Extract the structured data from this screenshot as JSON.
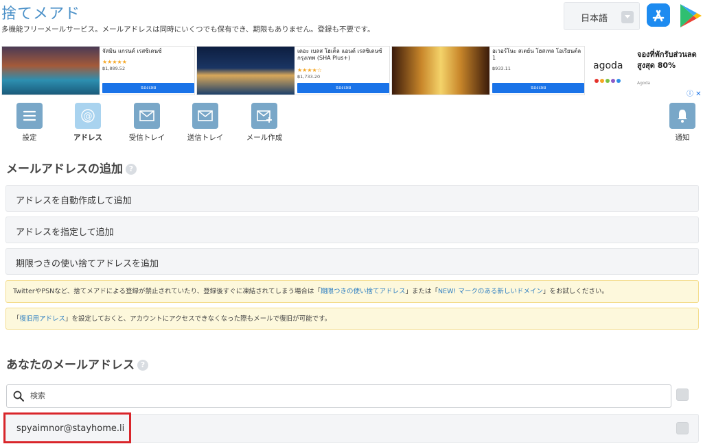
{
  "header": {
    "logo": "捨てメアド",
    "tagline": "多機能フリーメールサービス。メールアドレスは同時にいくつでも保有でき、期限もありません。登録も不要です。",
    "language": "日本語"
  },
  "ad": {
    "cards": [
      {
        "title": "จัสมิน แกรนด์ เรสซิเดนซ์",
        "stars": "★★★★★",
        "price": "฿1,889.52",
        "button": "จองเลย"
      },
      {
        "title": "เดอะ เบลส โฮเต็ล แอนด์ เรสซิเดนซ์ กรุงเทพ (SHA Plus+)",
        "stars": "★★★★☆",
        "price": "฿1,733.20",
        "button": "จองเลย"
      },
      {
        "title": "อเวอร์โนะ สเตย์น โฮสเทล โอเรียนต์ล 1",
        "stars": "",
        "price": "฿933.11",
        "button": "จองเลย"
      }
    ],
    "brand": "agoda",
    "promo": "จองที่พักรับส่วนลดสูงสุด 80%",
    "brand_small": "Agoda",
    "adchoice": "ⓘ ✕"
  },
  "nav": {
    "settings": "設定",
    "address": "アドレス",
    "inbox": "受信トレイ",
    "sent": "送信トレイ",
    "compose": "メール作成",
    "notify": "通知"
  },
  "add_section": {
    "title": "メールアドレスの追加",
    "auto": "アドレスを自動作成して追加",
    "specify": "アドレスを指定して追加",
    "temp": "期限つきの使い捨てアドレスを追加"
  },
  "notices": {
    "n1_pre": "TwitterやPSNなど、捨てメアドによる登録が禁止されていたり、登録後すぐに凍結されてしまう場合は「",
    "n1_link1": "期限つきの使い捨てアドレス",
    "n1_mid": "」または「",
    "n1_link2": "NEW! マークのある新しいドメイン",
    "n1_post": "」をお試しください。",
    "n2_pre": "「",
    "n2_link": "復旧用アドレス",
    "n2_post": "」を設定しておくと、アカウントにアクセスできなくなった際もメールで復旧が可能です。"
  },
  "your_section": {
    "title": "あなたのメールアドレス",
    "search_placeholder": "検索",
    "address": "spyaimnor@stayhome.li"
  },
  "colors": {
    "logo": "#4a90c8",
    "nav_icon": "#79a7c8",
    "nav_icon_active": "#a9d3ef",
    "notice_bg": "#fdf8dc",
    "link": "#2f7fc2",
    "highlight": "#d9252a"
  }
}
